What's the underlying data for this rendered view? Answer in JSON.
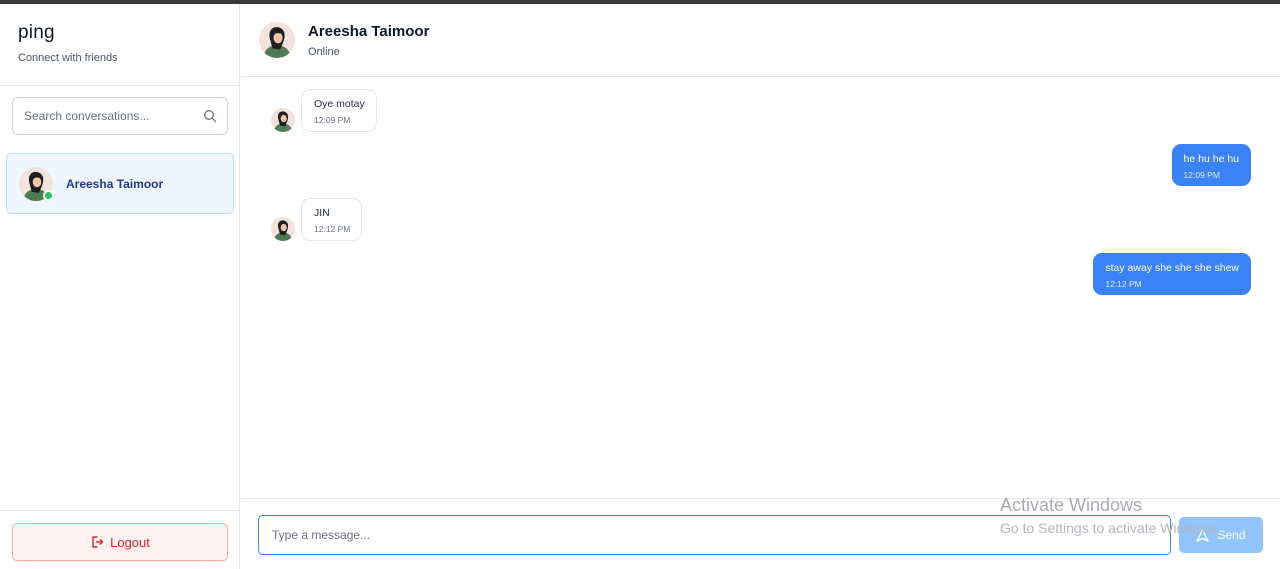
{
  "app": {
    "title": "ping",
    "tagline": "Connect with friends"
  },
  "sidebar": {
    "search_placeholder": "Search conversations...",
    "conversations": [
      {
        "name": "Areesha Taimoor",
        "online": true,
        "selected": true
      }
    ],
    "logout_label": "Logout"
  },
  "chat": {
    "contact_name": "Areesha Taimoor",
    "contact_status": "Online",
    "messages": [
      {
        "direction": "incoming",
        "text": "Oye motay",
        "time": "12:09 PM"
      },
      {
        "direction": "outgoing",
        "text": "he hu he hu",
        "time": "12:09 PM"
      },
      {
        "direction": "incoming",
        "text": "JIN",
        "time": "12:12 PM"
      },
      {
        "direction": "outgoing",
        "text": "stay away she she she shew",
        "time": "12:12 PM"
      }
    ],
    "composer_placeholder": "Type a message...",
    "send_label": "Send"
  },
  "watermark": {
    "title": "Activate Windows",
    "subtitle": "Go to Settings to activate Windows."
  },
  "colors": {
    "accent": "#3b82f6",
    "send_disabled": "#93c5fd",
    "online": "#22c55e",
    "logout": "#dc2626",
    "selected_bg": "#eff6ff"
  },
  "icons": {
    "search": "search-icon",
    "logout": "logout-icon",
    "send": "send-icon",
    "avatar": "avatar-illustration"
  }
}
